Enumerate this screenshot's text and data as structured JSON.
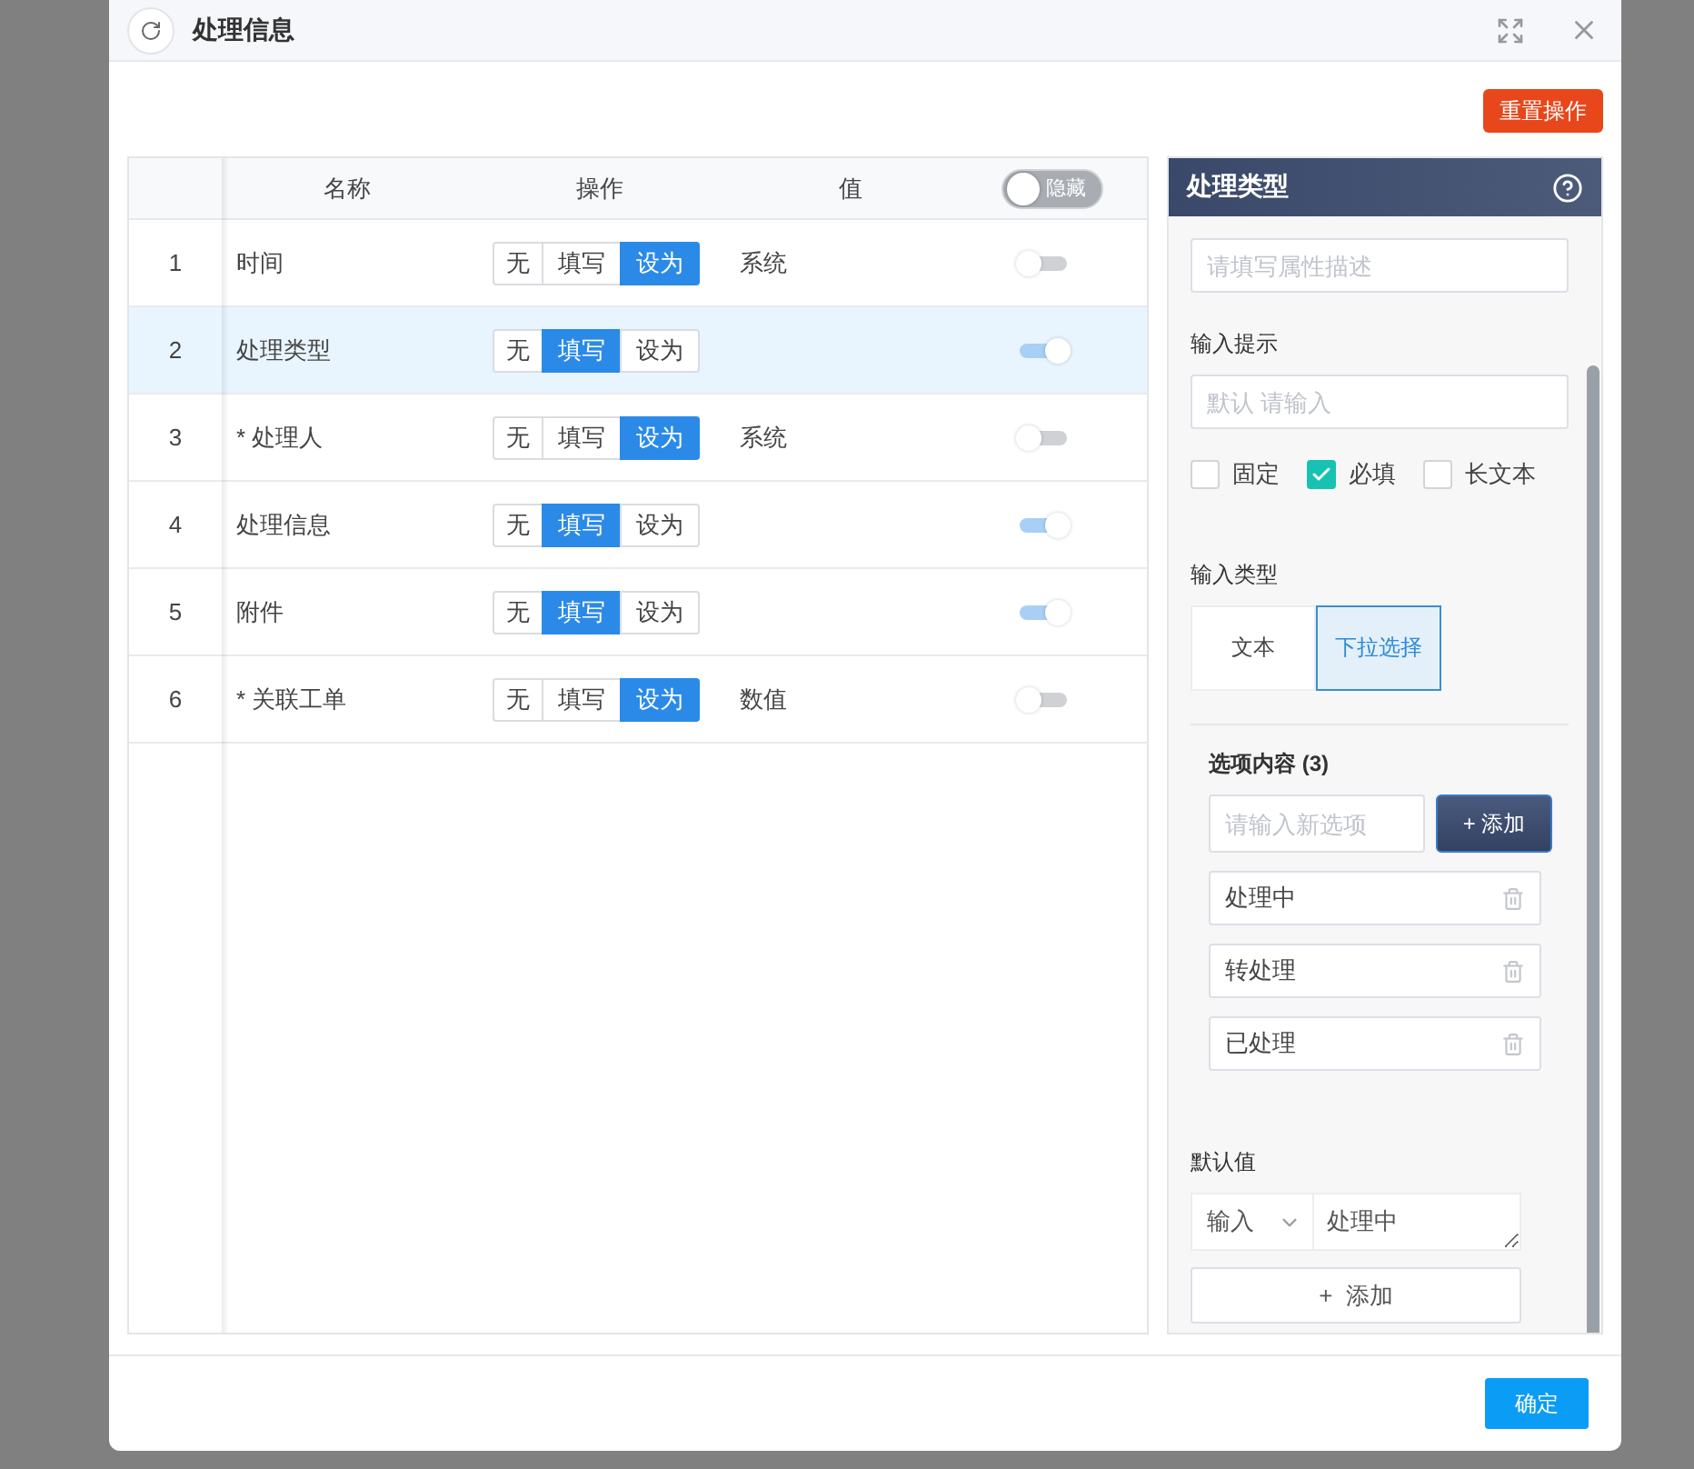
{
  "window": {
    "title": "处理信息"
  },
  "reset_button": "重置操作",
  "table": {
    "columns": [
      "名称",
      "操作",
      "值"
    ],
    "hide_toggle": {
      "label": "隐藏",
      "on": false
    },
    "rows": [
      {
        "index": "1",
        "name": "时间",
        "selected": false,
        "ops": [
          {
            "label": "无",
            "selected": false
          },
          {
            "label": "填写",
            "selected": false
          },
          {
            "label": "设为",
            "selected": true
          }
        ],
        "value": "系统",
        "on": false
      },
      {
        "index": "2",
        "name": "处理类型",
        "selected": true,
        "ops": [
          {
            "label": "无",
            "selected": false
          },
          {
            "label": "填写",
            "selected": true
          },
          {
            "label": "设为",
            "selected": false
          }
        ],
        "on": true
      },
      {
        "index": "3",
        "name": "* 处理人",
        "selected": false,
        "ops": [
          {
            "label": "无",
            "selected": false
          },
          {
            "label": "填写",
            "selected": false
          },
          {
            "label": "设为",
            "selected": true
          }
        ],
        "value": "系统",
        "on": false
      },
      {
        "index": "4",
        "name": "处理信息",
        "selected": false,
        "ops": [
          {
            "label": "无",
            "selected": false
          },
          {
            "label": "填写",
            "selected": true
          },
          {
            "label": "设为",
            "selected": false
          }
        ],
        "on": true
      },
      {
        "index": "5",
        "name": "附件",
        "selected": false,
        "ops": [
          {
            "label": "无",
            "selected": false
          },
          {
            "label": "填写",
            "selected": true
          },
          {
            "label": "设为",
            "selected": false
          }
        ],
        "on": true
      },
      {
        "index": "6",
        "name": "* 关联工单",
        "selected": false,
        "ops": [
          {
            "label": "无",
            "selected": false
          },
          {
            "label": "填写",
            "selected": false
          },
          {
            "label": "设为",
            "selected": true
          }
        ],
        "value": "数值",
        "on": false
      }
    ]
  },
  "panel": {
    "title": "处理类型",
    "description": {
      "placeholder": "请填写属性描述"
    },
    "hint": {
      "label": "输入提示",
      "placeholder": "默认 请输入"
    },
    "checkboxes": [
      {
        "label": "固定",
        "checked": false
      },
      {
        "label": "必填",
        "checked": true
      },
      {
        "label": "长文本",
        "checked": false
      }
    ],
    "input_type": {
      "label": "输入类型",
      "options": [
        {
          "label": "文本",
          "selected": false
        },
        {
          "label": "下拉选择",
          "selected": true
        }
      ]
    },
    "options": {
      "label": "选项内容 (3)",
      "placeholder": "请输入新选项",
      "add": "+ 添加",
      "items": [
        "处理中",
        "转处理",
        "已处理"
      ]
    },
    "default": {
      "label": "默认值",
      "mode": "输入",
      "value": "处理中",
      "add": "+  添加"
    }
  },
  "confirm": "确定"
}
